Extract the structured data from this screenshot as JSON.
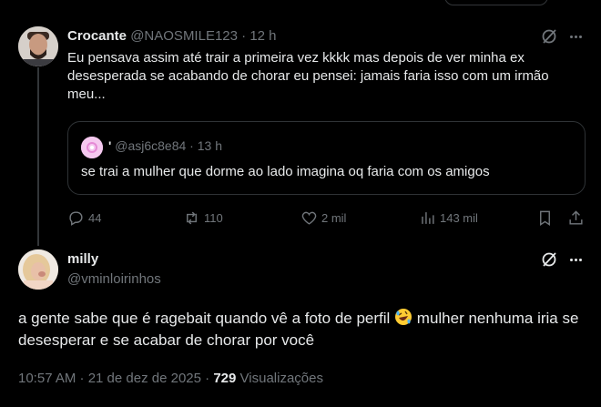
{
  "reply": {
    "name": "Crocante",
    "handle": "@NAOSMILE123",
    "separator": "·",
    "time": "12 h",
    "text": "Eu pensava assim até trair a primeira vez kkkk mas depois de ver minha ex desesperada se acabando de chorar eu pensei: jamais faria isso com um irmão meu...",
    "quote": {
      "name": "'",
      "handle": "@asj6c8e84",
      "separator": "·",
      "time": "13 h",
      "text": "se trai a mulher que dorme ao lado imagina oq faria com os amigos"
    },
    "actions": {
      "replies": "44",
      "reposts": "110",
      "likes": "2 mil",
      "views": "143 mil"
    }
  },
  "main": {
    "name": "milly",
    "handle": "@vminloirinhos",
    "text_before_emoji": "a gente sabe que é ragebait quando vê a foto de perfil",
    "emoji": "rolling-on-floor-laughing",
    "text_after_emoji": " mulher nenhuma iria se desesperar e se acabar de chorar por você",
    "timestamp": "10:57 AM · 21 de dez de 2025 ·",
    "views_count": "729",
    "views_label": "Visualizações"
  },
  "colors": {
    "background": "#000000",
    "text": "#e7e9ea",
    "muted": "#71767b",
    "border": "#2f3336"
  }
}
